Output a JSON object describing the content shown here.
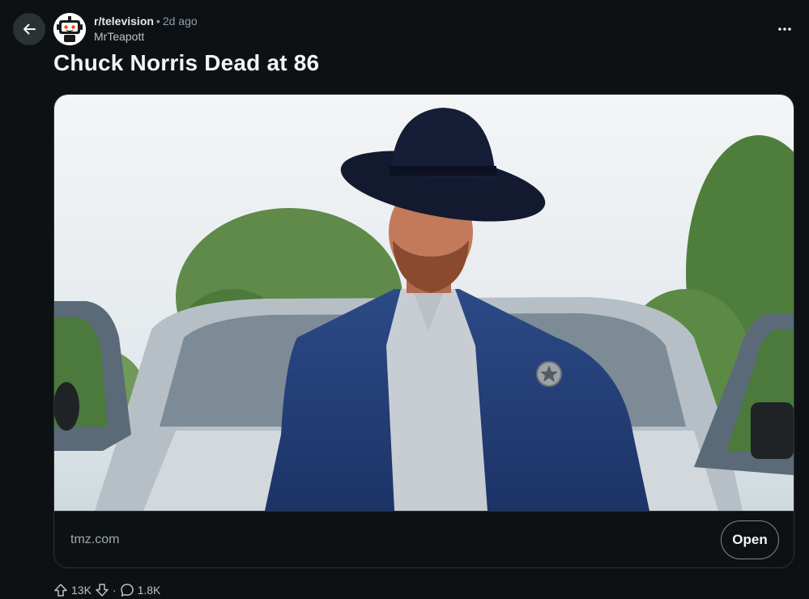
{
  "post": {
    "subreddit": "r/television",
    "separator": "•",
    "time_ago": "2d ago",
    "author": "MrTeapott",
    "title": "Chuck Norris Dead at 86"
  },
  "link": {
    "domain": "tmz.com",
    "open_label": "Open"
  },
  "stats": {
    "upvotes": "13K",
    "separator": "·",
    "comments": "1.8K"
  },
  "icons": {
    "back": "arrow-left-icon",
    "more": "more-horizontal-icon",
    "upvote": "upvote-arrow-icon",
    "downvote": "downvote-arrow-icon",
    "comment": "comment-bubble-icon"
  },
  "colors": {
    "background": "#0e1113",
    "button_bg": "#2a3236",
    "border": "#2a3236",
    "muted_text": "#8ba2ad",
    "title_text": "#f2f4f5"
  }
}
